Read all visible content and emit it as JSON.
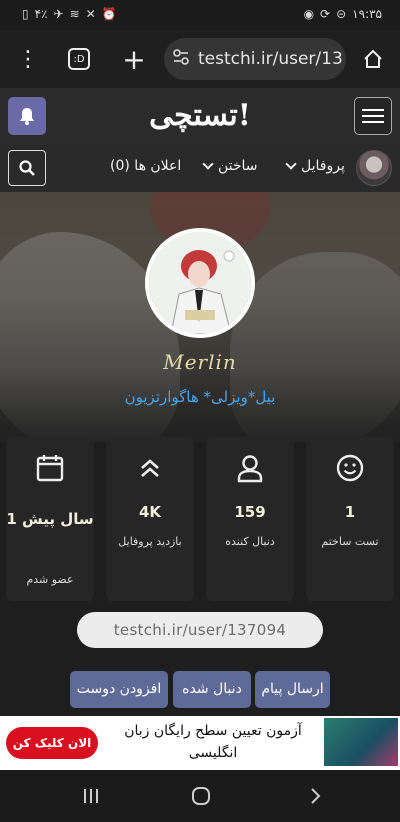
{
  "status_bar": {
    "battery": "۴٪",
    "time": "۱۹:۳۵"
  },
  "browser": {
    "tabs_label": ":D",
    "url": "testchi.ir/user/13"
  },
  "site": {
    "logo": "تستچی!"
  },
  "nav": {
    "profile_label": "پروفایل",
    "build_label": "ساختن",
    "notifications_label": "اعلان ها (0)"
  },
  "profile": {
    "username": "Merlin",
    "bio": "بیل*ویزلی* هاگوارتزیون",
    "url": "testchi.ir/user/137094"
  },
  "stats": {
    "tests_made": {
      "value": "1",
      "label": "تست ساختم"
    },
    "followers": {
      "value": "159",
      "label": "دنبال کننده"
    },
    "views": {
      "value": "4K",
      "label": "بازدید پروفایل"
    },
    "member": {
      "value": "1 سال پیش",
      "label": "عضو شدم"
    }
  },
  "actions": {
    "send_message": "ارسال پیام",
    "followed": "دنبال شده",
    "add_friend": "افزودن دوست"
  },
  "ad": {
    "text": "آزمون تعیین سطح رایگان زبان انگلیسی",
    "cta": "الان کلیک کن"
  },
  "colors": {
    "accent_button": "#5e6a98",
    "bell_button": "#6a6aa6",
    "bio_link": "#4aa3e6",
    "ad_cta": "#d90f1f"
  }
}
